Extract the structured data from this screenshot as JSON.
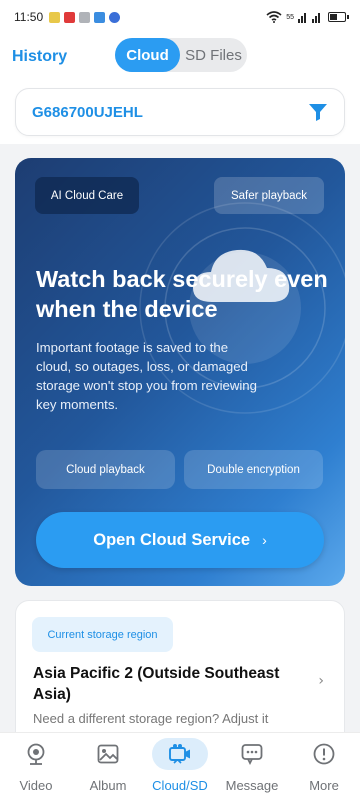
{
  "status_bar": {
    "time": "11:50",
    "network_speed": "55",
    "battery_label": "battery"
  },
  "header": {
    "history_label": "History",
    "tabs": [
      {
        "label": "Cloud",
        "active": true
      },
      {
        "label": "SD Files",
        "active": false
      }
    ]
  },
  "device": {
    "id": "G686700UJEHL",
    "filter_icon": "filter-icon"
  },
  "promo": {
    "chip_left": "AI Cloud Care",
    "chip_right": "Safer playback",
    "heading": "Watch back securely even when the device",
    "body": "Important footage is saved to the cloud, so outages, loss, or damaged storage won't stop you from reviewing key moments.",
    "features": [
      "Cloud playback",
      "Double encryption"
    ],
    "cta_label": "Open Cloud Service",
    "cta_chevron": "›"
  },
  "storage": {
    "badge": "Current storage region",
    "region": "Asia Pacific 2 (Outside Southeast Asia)",
    "chevron": "›",
    "hint": "Need a different storage region? Adjust it"
  },
  "bottom_nav": {
    "items": [
      {
        "label": "Video",
        "icon": "camera-icon",
        "active": false
      },
      {
        "label": "Album",
        "icon": "image-icon",
        "active": false
      },
      {
        "label": "Cloud/SD",
        "icon": "cloud-camera-icon",
        "active": true
      },
      {
        "label": "Message",
        "icon": "message-icon",
        "active": false
      },
      {
        "label": "More",
        "icon": "info-icon",
        "active": false
      }
    ]
  },
  "colors": {
    "accent": "#2b9cf2",
    "link": "#1e8fe5",
    "promo_start": "#1d3d72",
    "promo_end": "#5aa8ec"
  }
}
